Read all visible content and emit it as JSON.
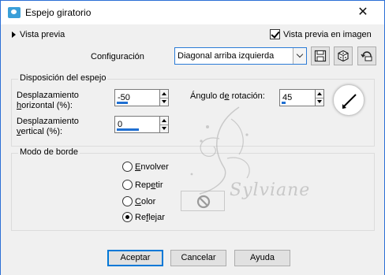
{
  "window": {
    "title": "Espejo giratorio",
    "close_symbol": "✕"
  },
  "header": {
    "preview_toggle_label": "Vista previa",
    "preview_in_image_label": "Vista previa en imagen",
    "preview_in_image_checked": true
  },
  "config": {
    "label": "Configuración",
    "selected": "Diagonal arriba izquierda",
    "buttons": [
      "save-preset-icon",
      "randomize-dice-icon",
      "reset-defaults-icon"
    ]
  },
  "mirror": {
    "legend": "Disposición del espejo",
    "horizontal": {
      "label_line1": "Desplazamiento",
      "label_line2_prefix": "",
      "label_line2_ul": "h",
      "label_line2_rest": "orizontal (%):",
      "value": "-50",
      "fill_fraction": 0.25
    },
    "vertical": {
      "label_line1": "Desplazamiento",
      "label_line2_prefix": "",
      "label_line2_ul": "v",
      "label_line2_rest": "ertical (%):",
      "value": "0",
      "fill_fraction": 0.5
    },
    "rotation": {
      "label_prefix": "Ángulo d",
      "label_ul": "e",
      "label_rest": " rotación:",
      "value": "45",
      "fill_fraction": 0.12
    }
  },
  "border": {
    "legend": "Modo de borde",
    "options": [
      {
        "pre": "",
        "ul": "E",
        "post": "nvolver",
        "selected": false
      },
      {
        "pre": "Rep",
        "ul": "e",
        "post": "tir",
        "selected": false
      },
      {
        "pre": "",
        "ul": "C",
        "post": "olor",
        "selected": false
      },
      {
        "pre": "Re",
        "ul": "f",
        "post": "lejar",
        "selected": true
      }
    ]
  },
  "watermark": {
    "text": "Sylviane"
  },
  "footer": {
    "ok": "Aceptar",
    "cancel": "Cancelar",
    "help": "Ayuda"
  },
  "colors": {
    "accent": "#0078d7",
    "spin_fill": "#1f6fd2",
    "title_bg": "#ffffff",
    "client_bg": "#f0f0f0"
  }
}
